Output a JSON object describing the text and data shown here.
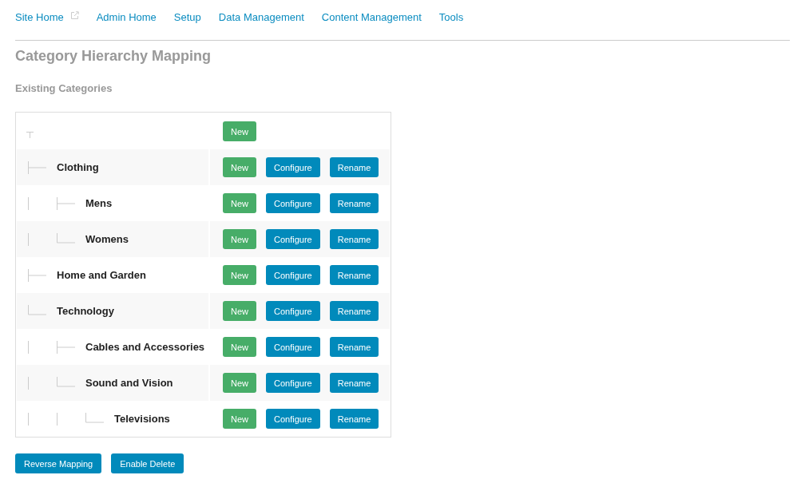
{
  "nav": [
    {
      "label": "Site Home",
      "external": true
    },
    {
      "label": "Admin Home",
      "external": false
    },
    {
      "label": "Setup",
      "external": false
    },
    {
      "label": "Data Management",
      "external": false
    },
    {
      "label": "Content Management",
      "external": false
    },
    {
      "label": "Tools",
      "external": false
    }
  ],
  "title": "Category Hierarchy Mapping",
  "section_title": "Existing Categories",
  "tree": {
    "root": {
      "buttons": [
        {
          "label": "New",
          "kind": "add"
        }
      ]
    },
    "children": [
      {
        "name": "Clothing",
        "buttons": [
          {
            "label": "New",
            "kind": "add"
          },
          {
            "label": "Configure",
            "kind": "action"
          },
          {
            "label": "Rename",
            "kind": "action"
          }
        ],
        "children": [
          {
            "name": "Mens",
            "buttons": [
              {
                "label": "New",
                "kind": "add"
              },
              {
                "label": "Configure",
                "kind": "action"
              },
              {
                "label": "Rename",
                "kind": "action"
              }
            ]
          },
          {
            "name": "Womens",
            "buttons": [
              {
                "label": "New",
                "kind": "add"
              },
              {
                "label": "Configure",
                "kind": "action"
              },
              {
                "label": "Rename",
                "kind": "action"
              }
            ]
          }
        ]
      },
      {
        "name": "Home and Garden",
        "buttons": [
          {
            "label": "New",
            "kind": "add"
          },
          {
            "label": "Configure",
            "kind": "action"
          },
          {
            "label": "Rename",
            "kind": "action"
          }
        ]
      },
      {
        "name": "Technology",
        "buttons": [
          {
            "label": "New",
            "kind": "add"
          },
          {
            "label": "Configure",
            "kind": "action"
          },
          {
            "label": "Rename",
            "kind": "action"
          }
        ],
        "children": [
          {
            "name": "Cables and Accessories",
            "buttons": [
              {
                "label": "New",
                "kind": "add"
              },
              {
                "label": "Configure",
                "kind": "action"
              },
              {
                "label": "Rename",
                "kind": "action"
              }
            ]
          },
          {
            "name": "Sound and Vision",
            "buttons": [
              {
                "label": "New",
                "kind": "add"
              },
              {
                "label": "Configure",
                "kind": "action"
              },
              {
                "label": "Rename",
                "kind": "action"
              }
            ],
            "children": [
              {
                "name": "Televisions",
                "buttons": [
                  {
                    "label": "New",
                    "kind": "add"
                  },
                  {
                    "label": "Configure",
                    "kind": "action"
                  },
                  {
                    "label": "Rename",
                    "kind": "action"
                  }
                ]
              }
            ]
          }
        ]
      }
    ]
  },
  "footer_buttons": [
    "Reverse Mapping",
    "Enable Delete"
  ]
}
